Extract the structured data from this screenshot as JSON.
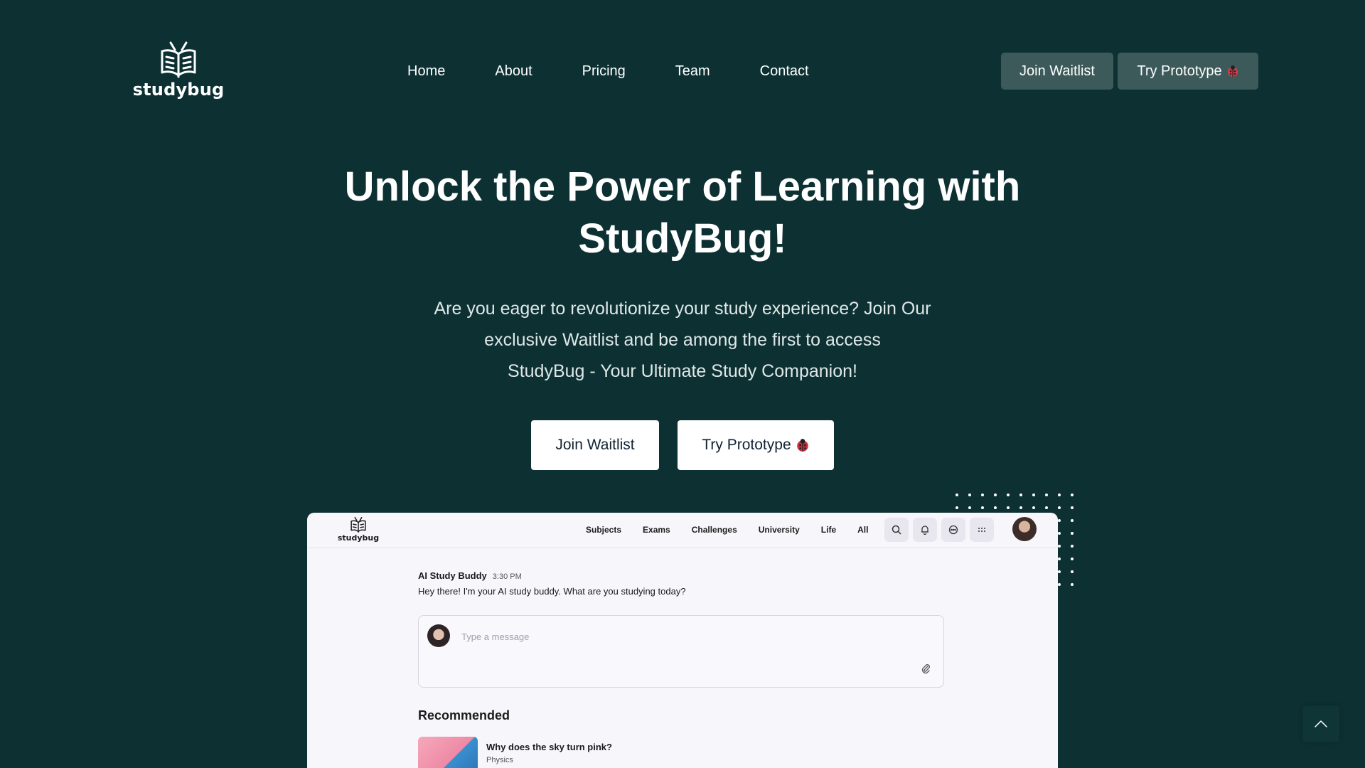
{
  "brand": {
    "logo_text": "studybug"
  },
  "nav": {
    "items": [
      {
        "label": "Home"
      },
      {
        "label": "About"
      },
      {
        "label": "Pricing"
      },
      {
        "label": "Team"
      },
      {
        "label": "Contact"
      }
    ],
    "join_waitlist": "Join Waitlist",
    "try_prototype": "Try Prototype"
  },
  "hero": {
    "title_line1": "Unlock the Power of Learning with",
    "title_line2": "StudyBug!",
    "subtitle_line1": "Are you eager to revolutionize your study experience? Join Our",
    "subtitle_line2": "exclusive Waitlist and be among the first to access",
    "subtitle_line3": "StudyBug - Your Ultimate Study Companion!",
    "join_waitlist": "Join Waitlist",
    "try_prototype": "Try Prototype"
  },
  "preview": {
    "logo_text": "studybug",
    "nav": [
      "Subjects",
      "Exams",
      "Challenges",
      "University",
      "Life",
      "All"
    ],
    "icons": [
      "search-icon",
      "bell-icon",
      "chat-icon",
      "grid-icon"
    ],
    "message": {
      "author": "AI Study Buddy",
      "time": "3:30 PM",
      "text": "Hey there! I'm your AI study buddy. What are you studying today?"
    },
    "input": {
      "placeholder": "Type a message"
    },
    "recommended": {
      "title": "Recommended",
      "items": [
        {
          "title": "Why does the sky turn pink?",
          "subject": "Physics"
        }
      ]
    }
  },
  "colors": {
    "background": "#0d3133",
    "nav_button": "#3d5a5b",
    "hero_button": "#ffffff",
    "preview_bg": "#f7f6fb"
  }
}
